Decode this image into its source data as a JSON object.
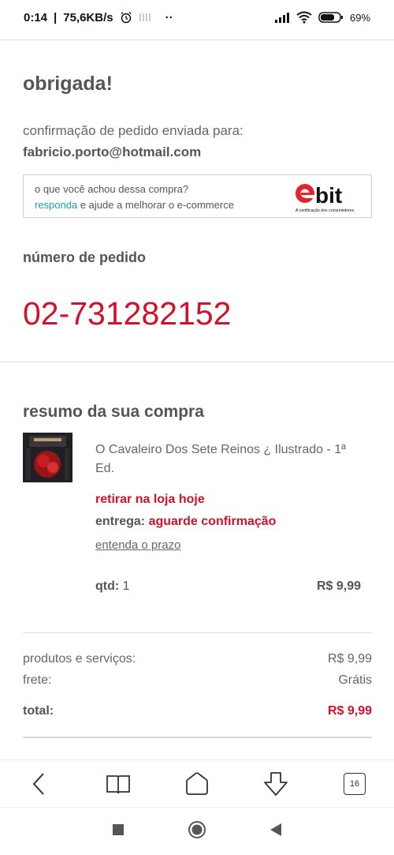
{
  "statusbar": {
    "time": "0:14",
    "net_speed": "75,6KB/s",
    "dots": "··",
    "battery": "69"
  },
  "confirmation": {
    "title": "obrigada!",
    "sent_to_label": "confirmação de pedido enviada para:",
    "email": "fabricio.porto@hotmail.com"
  },
  "ebit": {
    "question": "o que você achou dessa compra?",
    "link": "responda",
    "rest": " e ajude a melhorar o e-commerce",
    "logo_text": "bit",
    "logo_tagline": "A certificação dos consumidores"
  },
  "order": {
    "label": "número de pedido",
    "number": "02-731282152"
  },
  "summary": {
    "title": "resumo da sua compra",
    "product_name": "O Cavaleiro Dos Sete Reinos ¿ Ilustrado - 1ª Ed.",
    "pickup": "retirar na loja hoje",
    "delivery_label": "entrega:",
    "delivery_value": "aguarde confirmação",
    "prazo_link": "entenda o prazo",
    "qty_label": "qtd:",
    "qty_value": "1",
    "item_price": "R$ 9,99"
  },
  "totals": {
    "products_label": "produtos e serviços:",
    "products_value": "R$ 9,99",
    "shipping_label": "frete:",
    "shipping_value": "Grátis",
    "total_label": "total:",
    "total_value": "R$ 9,99"
  },
  "browser_nav": {
    "tab_count": "16"
  },
  "colors": {
    "accent_red": "#d2112b",
    "link_teal": "#1aa0b0"
  }
}
